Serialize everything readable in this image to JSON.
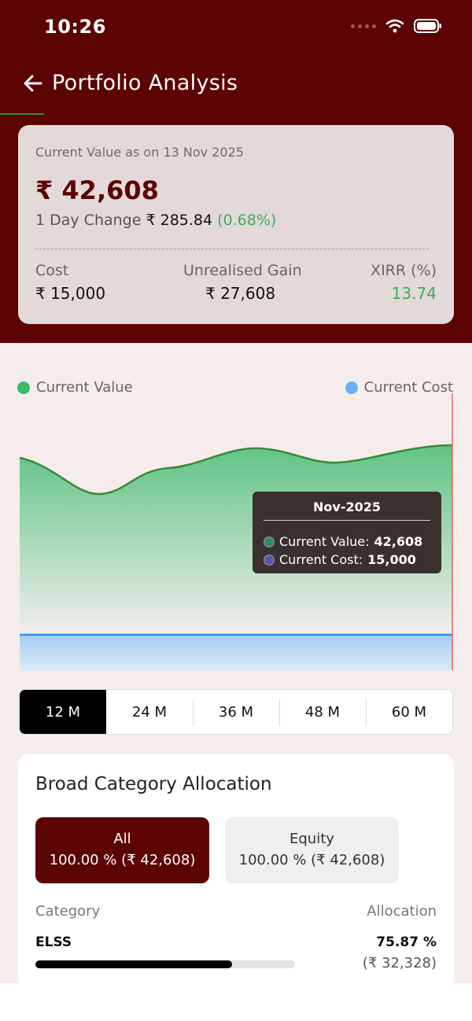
{
  "status_bar": {
    "time": "10:26"
  },
  "header": {
    "title": "Portfolio Analysis"
  },
  "summary": {
    "date_label": "Current Value as on 13 Nov 2025",
    "current_value": "₹ 42,608",
    "day_change_label": "1 Day Change",
    "day_change_value": "₹ 285.84",
    "day_change_pct": "(0.68%)",
    "cost_label": "Cost",
    "cost_value": "₹ 15,000",
    "gain_label": "Unrealised Gain",
    "gain_value": "₹ 27,608",
    "xirr_label": "XIRR (%)",
    "xirr_value": "13.74"
  },
  "chart_data": {
    "type": "area",
    "series": [
      {
        "name": "Current Value",
        "color": "#3dba6a"
      },
      {
        "name": "Current Cost",
        "color": "#6ab0f0"
      }
    ]
  },
  "tooltip": {
    "title": "Nov-2025",
    "value_label": "Current Value:",
    "value": "42,608",
    "cost_label": "Current Cost:",
    "cost": "15,000"
  },
  "periods": [
    {
      "label": "12 M",
      "active": true
    },
    {
      "label": "24 M",
      "active": false
    },
    {
      "label": "36 M",
      "active": false
    },
    {
      "label": "48 M",
      "active": false
    },
    {
      "label": "60 M",
      "active": false
    }
  ],
  "allocation": {
    "title": "Broad Category Allocation",
    "chips": [
      {
        "name": "All",
        "value": "100.00 % (₹ 42,608)"
      },
      {
        "name": "Equity",
        "value": "100.00 % (₹ 42,608)"
      }
    ],
    "category_header": "Category",
    "allocation_header": "Allocation",
    "rows": [
      {
        "name": "ELSS",
        "pct": "75.87 %",
        "amount": "(₹ 32,328)",
        "fraction": 0.7587
      }
    ]
  },
  "colors": {
    "brand": "#5c0303",
    "positive": "#3daa5c"
  }
}
